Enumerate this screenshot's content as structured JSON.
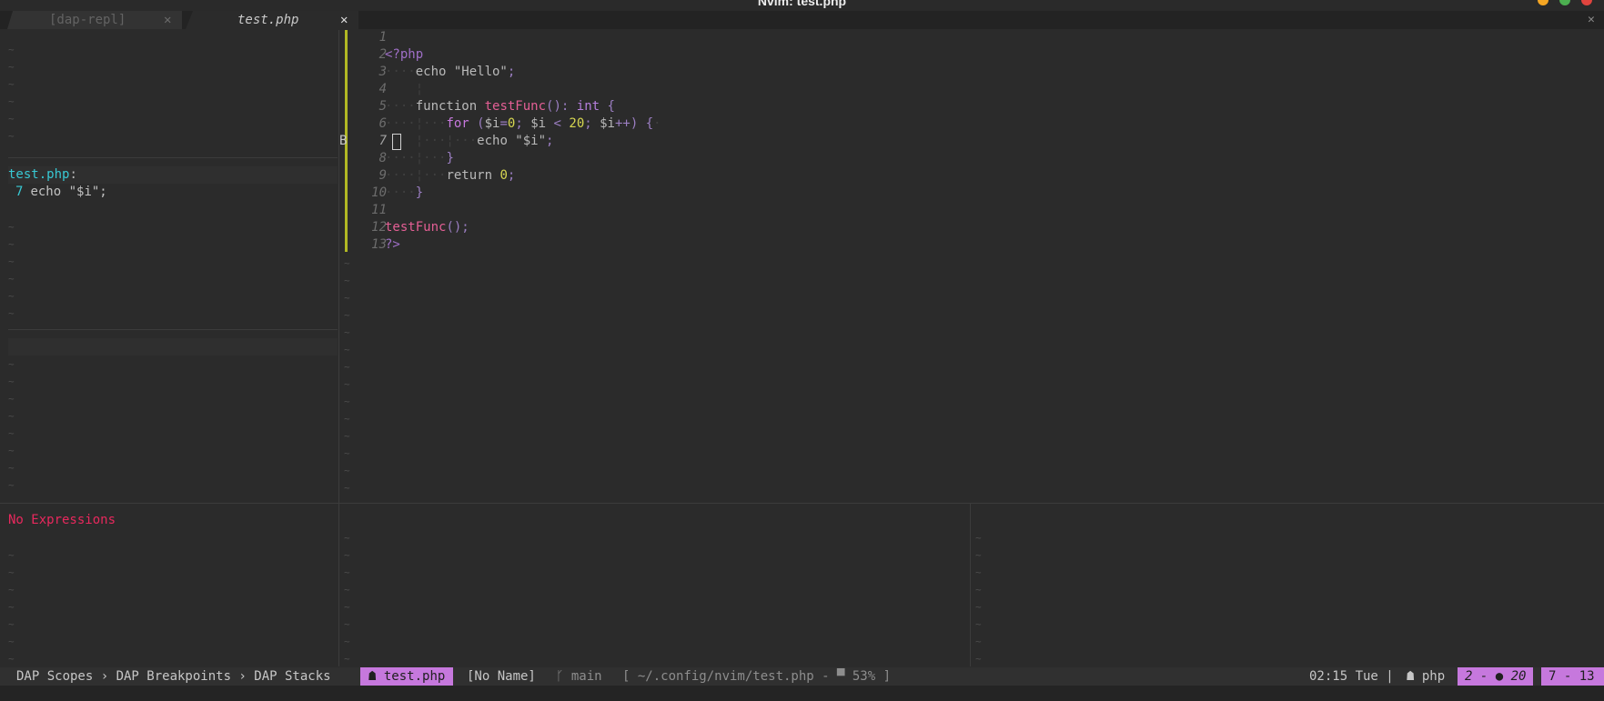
{
  "window": {
    "title": "Nvim: test.php"
  },
  "tabs": [
    {
      "label": "[dap-repl]",
      "close": "✕",
      "active": false
    },
    {
      "label": "test.php",
      "close": "✕",
      "active": true
    }
  ],
  "tabline_close": "✕",
  "breakpoints": {
    "file": "test.php",
    "colon": ":",
    "line_number": "7",
    "line_text": "echo \"$i\";"
  },
  "watches": {
    "empty_text": "No Expressions"
  },
  "tilde": "~",
  "editor": {
    "sign": "B",
    "line_numbers": [
      "1",
      "2",
      "3",
      "4",
      "5",
      "6",
      "7",
      "8",
      "9",
      "10",
      "11",
      "12",
      "13"
    ],
    "lines": [
      "",
      "<?php",
      "    echo \"Hello\";",
      "",
      "    function testFunc(): int {",
      "        for ($i=0; $i < 20; $i++) {",
      "            echo \"$i\";",
      "        }",
      "        return 0;",
      "    }",
      "",
      "testFunc();",
      "?>"
    ]
  },
  "statusline": {
    "winbar": "DAP Scopes › DAP Breakpoints › DAP Stacks",
    "file": "test.php",
    "file_icon": "php-icon",
    "noname": "[No Name]",
    "branch": "main",
    "branch_icon": "git-branch-icon",
    "path": "[ ~/.config/nvim/test.php - ▀ 53% ]",
    "time": "02:15 Tue |",
    "lang": "php",
    "diagnostics": "2 - ● 20",
    "position": "7 - 13"
  },
  "colors": {
    "accent": "#c678dd",
    "git_added": "#b1b823",
    "error": "#e8285d",
    "cyan": "#38c8d3",
    "number": "#d7d751",
    "function": "#e45f95"
  }
}
